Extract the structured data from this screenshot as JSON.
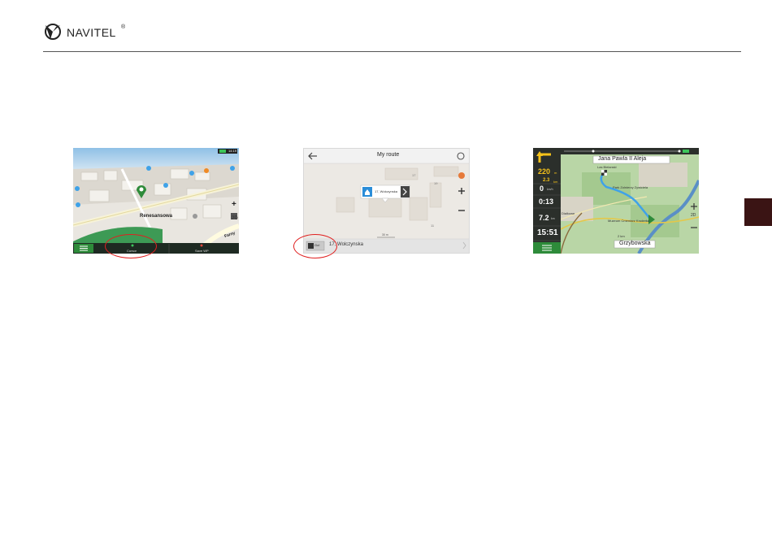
{
  "header": {
    "logo_text": "NAVITEL",
    "logo_mark": "®"
  },
  "screen1": {
    "street_label": "Renesansowa",
    "street_label_2": "Farny",
    "zoom_label": "2D",
    "cursor_button_label": "Cursor",
    "save_wp_label": "Save WP",
    "battery_time": "14:19"
  },
  "screen2": {
    "title": "My route",
    "popup_address": "17, Wolczynska",
    "scale_label": "30 m",
    "go_button_label": "Go!",
    "route_address": "17, Wolczynska",
    "building_numbers": [
      "17",
      "19",
      "11"
    ]
  },
  "screen3": {
    "top_street": "Jana Pawla II Aleja",
    "bottom_street": "Grzybowska",
    "map_labels": [
      "Las Bielanski",
      "Park Zolnierzy Zywiciela",
      "Dialkowe",
      "Muzeum Cmentarz Kruderka",
      "2 km"
    ],
    "turn_distance": "220",
    "turn_distance_unit": "m",
    "next_distance": "2.3",
    "next_distance_unit": "km",
    "speed": "0",
    "speed_unit": "km/h",
    "time_remaining": "0:13",
    "distance_remaining": "7.2",
    "distance_remaining_unit": "km",
    "arrival_time": "15:51",
    "zoom_label": "2D"
  },
  "colors": {
    "navitel_green": "#2e8b3a",
    "route_blue": "#3fa2e8",
    "highlight_red": "#e02020",
    "side_tab": "#3a1414"
  }
}
